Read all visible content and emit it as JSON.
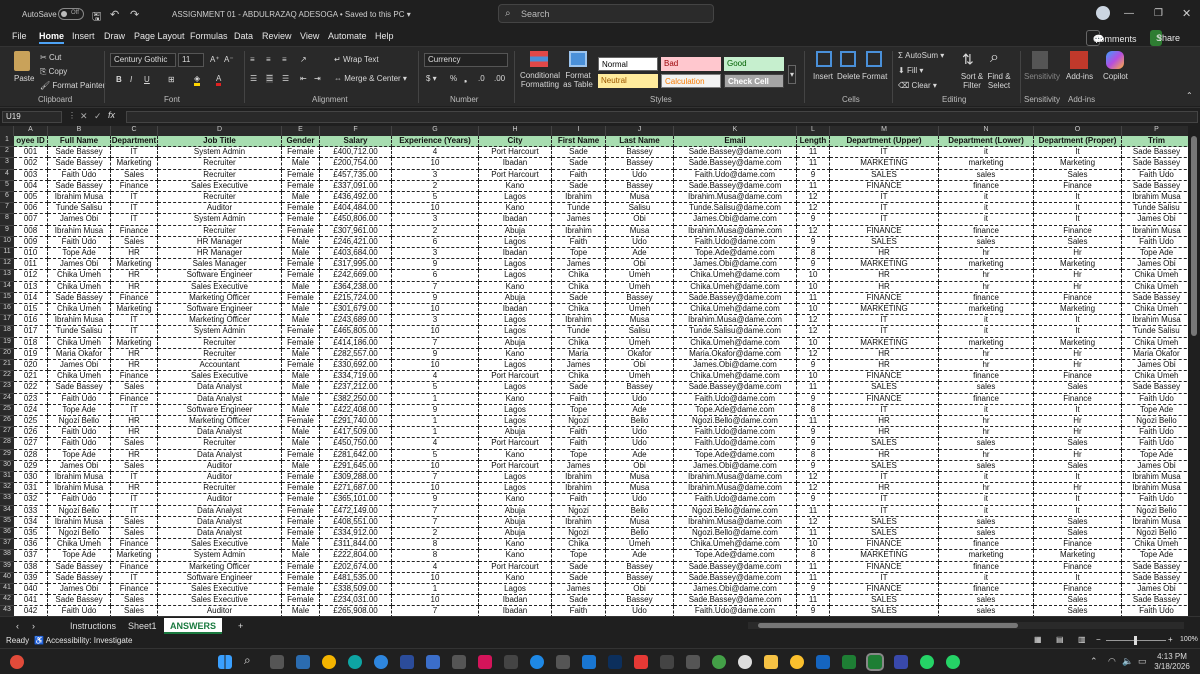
{
  "titlebar": {
    "autosave": "AutoSave",
    "autosave_state": "Off",
    "doc": "ASSIGNMENT 01 - ABDULRAZAQ ADESOGA  •  Saved to this PC ▾",
    "search": "Search"
  },
  "menu": [
    "File",
    "Home",
    "Insert",
    "Draw",
    "Page Layout",
    "Formulas",
    "Data",
    "Review",
    "View",
    "Automate",
    "Help"
  ],
  "comments": "Comments",
  "share": "Share",
  "ribbon": {
    "paste": "Paste",
    "cut": "Cut",
    "copy": "Copy",
    "format_painter": "Format Painter",
    "clipboard": "Clipboard",
    "font_name": "Century Gothic",
    "font_size": "11",
    "font": "Font",
    "wrap_text": "Wrap Text",
    "merge_center": "Merge & Center",
    "alignment": "Alignment",
    "number_format": "Currency",
    "number": "Number",
    "cond_fmt": "Conditional Formatting",
    "format_table": "Format as Table",
    "styles": [
      "Normal",
      "Bad",
      "Good",
      "Neutral",
      "Calculation",
      "Check Cell"
    ],
    "styles_group": "Styles",
    "insert": "Insert",
    "delete": "Delete",
    "format": "Format",
    "cells": "Cells",
    "autosum": "AutoSum",
    "fill": "Fill",
    "clear": "Clear",
    "sort_filter": "Sort & Filter",
    "find_select": "Find & Select",
    "editing": "Editing",
    "sensitivity": "Sensitivity",
    "addins": "Add-ins",
    "copilot": "Copilot",
    "addins_group": "Add-ins"
  },
  "namebox": "U19",
  "columns": [
    "A",
    "B",
    "C",
    "D",
    "E",
    "F",
    "G",
    "H",
    "I",
    "J",
    "K",
    "L",
    "M",
    "N",
    "O",
    "P"
  ],
  "headers": [
    "oyee ID",
    "Full Name",
    "Department",
    "Job Title",
    "Gender",
    "Salary",
    "Experience (Years)",
    "City",
    "First Name",
    "Last Name",
    "Email",
    "Length",
    "Department (Upper)",
    "Department (Lower)",
    "Department (Proper)",
    "Trim"
  ],
  "rows": [
    [
      "001",
      "Sade Bassey",
      "IT",
      "System Admin",
      "Female",
      "£400,712.00",
      "4",
      "Port Harcourt",
      "Sade",
      "Bassey",
      "Sade.Bassey@dame.com",
      "11",
      "IT",
      "it",
      "It",
      "Sade Bassey"
    ],
    [
      "002",
      "Sade Bassey",
      "Marketing",
      "Recruiter",
      "Male",
      "£200,754.00",
      "10",
      "Ibadan",
      "Sade",
      "Bassey",
      "Sade.Bassey@dame.com",
      "11",
      "MARKETING",
      "marketing",
      "Marketing",
      "Sade Bassey"
    ],
    [
      "003",
      "Faith Udo",
      "Sales",
      "Recruiter",
      "Female",
      "£457,735.00",
      "3",
      "Port Harcourt",
      "Faith",
      "Udo",
      "Faith.Udo@dame.com",
      "9",
      "SALES",
      "sales",
      "Sales",
      "Faith Udo"
    ],
    [
      "004",
      "Sade Bassey",
      "Finance",
      "Sales Executive",
      "Female",
      "£337,091.00",
      "2",
      "Kano",
      "Sade",
      "Bassey",
      "Sade.Bassey@dame.com",
      "11",
      "FINANCE",
      "finance",
      "Finance",
      "Sade Bassey"
    ],
    [
      "005",
      "Ibrahim Musa",
      "IT",
      "Recruiter",
      "Male",
      "£436,492.00",
      "5",
      "Lagos",
      "Ibrahim",
      "Musa",
      "Ibrahim.Musa@dame.com",
      "12",
      "IT",
      "it",
      "It",
      "Ibrahim Musa"
    ],
    [
      "006",
      "Tunde Salisu",
      "IT",
      "Auditor",
      "Female",
      "£404,484.00",
      "10",
      "Kano",
      "Tunde",
      "Salisu",
      "Tunde.Salisu@dame.com",
      "12",
      "IT",
      "it",
      "It",
      "Tunde Salisu"
    ],
    [
      "007",
      "James Obi",
      "IT",
      "System Admin",
      "Female",
      "£450,806.00",
      "3",
      "Ibadan",
      "James",
      "Obi",
      "James.Obi@dame.com",
      "9",
      "IT",
      "it",
      "It",
      "James Obi"
    ],
    [
      "008",
      "Ibrahim Musa",
      "Finance",
      "Recruiter",
      "Female",
      "£307,961.00",
      "2",
      "Abuja",
      "Ibrahim",
      "Musa",
      "Ibrahim.Musa@dame.com",
      "12",
      "FINANCE",
      "finance",
      "Finance",
      "Ibrahim Musa"
    ],
    [
      "009",
      "Faith Udo",
      "Sales",
      "HR Manager",
      "Male",
      "£246,421.00",
      "6",
      "Lagos",
      "Faith",
      "Udo",
      "Faith.Udo@dame.com",
      "9",
      "SALES",
      "sales",
      "Sales",
      "Faith Udo"
    ],
    [
      "010",
      "Tope Ade",
      "HR",
      "HR Manager",
      "Male",
      "£403,684.00",
      "3",
      "Ibadan",
      "Tope",
      "Ade",
      "Tope.Ade@dame.com",
      "8",
      "HR",
      "hr",
      "Hr",
      "Tope Ade"
    ],
    [
      "011",
      "James Obi",
      "Marketing",
      "Sales Manager",
      "Female",
      "£317,995.00",
      "9",
      "Lagos",
      "James",
      "Obi",
      "James.Obi@dame.com",
      "9",
      "MARKETING",
      "marketing",
      "Marketing",
      "James Obi"
    ],
    [
      "012",
      "Chika Umeh",
      "HR",
      "Software Engineer",
      "Female",
      "£242,669.00",
      "6",
      "Lagos",
      "Chika",
      "Umeh",
      "Chika.Umeh@dame.com",
      "10",
      "HR",
      "hr",
      "Hr",
      "Chika Umeh"
    ],
    [
      "013",
      "Chika Umeh",
      "HR",
      "Sales Executive",
      "Male",
      "£364,238.00",
      "7",
      "Kano",
      "Chika",
      "Umeh",
      "Chika.Umeh@dame.com",
      "10",
      "HR",
      "hr",
      "Hr",
      "Chika Umeh"
    ],
    [
      "014",
      "Sade Bassey",
      "Finance",
      "Marketing Officer",
      "Female",
      "£215,724.00",
      "9",
      "Abuja",
      "Sade",
      "Bassey",
      "Sade.Bassey@dame.com",
      "11",
      "FINANCE",
      "finance",
      "Finance",
      "Sade Bassey"
    ],
    [
      "015",
      "Chika Umeh",
      "Marketing",
      "Software Engineer",
      "Male",
      "£301,679.00",
      "10",
      "Ibadan",
      "Chika",
      "Umeh",
      "Chika.Umeh@dame.com",
      "10",
      "MARKETING",
      "marketing",
      "Marketing",
      "Chika Umeh"
    ],
    [
      "016",
      "Ibrahim Musa",
      "IT",
      "Marketing Officer",
      "Male",
      "£243,689.00",
      "3",
      "Lagos",
      "Ibrahim",
      "Musa",
      "Ibrahim.Musa@dame.com",
      "12",
      "IT",
      "it",
      "It",
      "Ibrahim Musa"
    ],
    [
      "017",
      "Tunde Salisu",
      "IT",
      "System Admin",
      "Female",
      "£465,805.00",
      "10",
      "Lagos",
      "Tunde",
      "Salisu",
      "Tunde.Salisu@dame.com",
      "12",
      "IT",
      "it",
      "It",
      "Tunde Salisu"
    ],
    [
      "018",
      "Chika Umeh",
      "Marketing",
      "Recruiter",
      "Female",
      "£414,186.00",
      "7",
      "Abuja",
      "Chika",
      "Umeh",
      "Chika.Umeh@dame.com",
      "10",
      "MARKETING",
      "marketing",
      "Marketing",
      "Chika Umeh"
    ],
    [
      "019",
      "Maria Okafor",
      "HR",
      "Recruiter",
      "Male",
      "£282,557.00",
      "9",
      "Kano",
      "Maria",
      "Okafor",
      "Maria.Okafor@dame.com",
      "12",
      "HR",
      "hr",
      "Hr",
      "Maria Okafor"
    ],
    [
      "020",
      "James Obi",
      "HR",
      "Accountant",
      "Female",
      "£330,692.00",
      "10",
      "Lagos",
      "James",
      "Obi",
      "James.Obi@dame.com",
      "9",
      "HR",
      "hr",
      "Hr",
      "James Obi"
    ],
    [
      "021",
      "Chika Umeh",
      "Finance",
      "Sales Executive",
      "Male",
      "£334,719.00",
      "4",
      "Port Harcourt",
      "Chika",
      "Umeh",
      "Chika.Umeh@dame.com",
      "10",
      "FINANCE",
      "finance",
      "Finance",
      "Chika Umeh"
    ],
    [
      "022",
      "Sade Bassey",
      "Sales",
      "Data Analyst",
      "Male",
      "£237,212.00",
      "5",
      "Lagos",
      "Sade",
      "Bassey",
      "Sade.Bassey@dame.com",
      "11",
      "SALES",
      "sales",
      "Sales",
      "Sade Bassey"
    ],
    [
      "023",
      "Faith Udo",
      "Finance",
      "Data Analyst",
      "Male",
      "£382,250.00",
      "1",
      "Kano",
      "Faith",
      "Udo",
      "Faith.Udo@dame.com",
      "9",
      "FINANCE",
      "finance",
      "Finance",
      "Faith Udo"
    ],
    [
      "024",
      "Tope Ade",
      "IT",
      "Software Engineer",
      "Male",
      "£422,408.00",
      "9",
      "Lagos",
      "Tope",
      "Ade",
      "Tope.Ade@dame.com",
      "8",
      "IT",
      "it",
      "It",
      "Tope Ade"
    ],
    [
      "025",
      "Ngozi Bello",
      "HR",
      "Marketing Officer",
      "Female",
      "£291,740.00",
      "1",
      "Lagos",
      "Ngozi",
      "Bello",
      "Ngozi.Bello@dame.com",
      "11",
      "HR",
      "hr",
      "Hr",
      "Ngozi Bello"
    ],
    [
      "026",
      "Faith Udo",
      "HR",
      "Data Analyst",
      "Male",
      "£417,509.00",
      "1",
      "Abuja",
      "Faith",
      "Udo",
      "Faith.Udo@dame.com",
      "9",
      "HR",
      "hr",
      "Hr",
      "Faith Udo"
    ],
    [
      "027",
      "Faith Udo",
      "Sales",
      "Recruiter",
      "Male",
      "£450,750.00",
      "4",
      "Port Harcourt",
      "Faith",
      "Udo",
      "Faith.Udo@dame.com",
      "9",
      "SALES",
      "sales",
      "Sales",
      "Faith Udo"
    ],
    [
      "028",
      "Tope Ade",
      "HR",
      "Data Analyst",
      "Female",
      "£281,642.00",
      "5",
      "Kano",
      "Tope",
      "Ade",
      "Tope.Ade@dame.com",
      "8",
      "HR",
      "hr",
      "Hr",
      "Tope Ade"
    ],
    [
      "029",
      "James Obi",
      "Sales",
      "Auditor",
      "Male",
      "£291,645.00",
      "10",
      "Port Harcourt",
      "James",
      "Obi",
      "James.Obi@dame.com",
      "9",
      "SALES",
      "sales",
      "Sales",
      "James Obi"
    ],
    [
      "030",
      "Ibrahim Musa",
      "IT",
      "Auditor",
      "Female",
      "£309,288.00",
      "7",
      "Lagos",
      "Ibrahim",
      "Musa",
      "Ibrahim.Musa@dame.com",
      "12",
      "IT",
      "it",
      "It",
      "Ibrahim Musa"
    ],
    [
      "031",
      "Ibrahim Musa",
      "HR",
      "Recruiter",
      "Female",
      "£271,687.00",
      "10",
      "Lagos",
      "Ibrahim",
      "Musa",
      "Ibrahim.Musa@dame.com",
      "12",
      "HR",
      "hr",
      "Hr",
      "Ibrahim Musa"
    ],
    [
      "032",
      "Faith Udo",
      "IT",
      "Auditor",
      "Female",
      "£365,101.00",
      "9",
      "Kano",
      "Faith",
      "Udo",
      "Faith.Udo@dame.com",
      "9",
      "IT",
      "it",
      "It",
      "Faith Udo"
    ],
    [
      "033",
      "Ngozi Bello",
      "IT",
      "Data Analyst",
      "Female",
      "£472,149.00",
      "7",
      "Abuja",
      "Ngozi",
      "Bello",
      "Ngozi.Bello@dame.com",
      "11",
      "IT",
      "it",
      "It",
      "Ngozi Bello"
    ],
    [
      "034",
      "Ibrahim Musa",
      "Sales",
      "Data Analyst",
      "Female",
      "£408,551.00",
      "7",
      "Abuja",
      "Ibrahim",
      "Musa",
      "Ibrahim.Musa@dame.com",
      "12",
      "SALES",
      "sales",
      "Sales",
      "Ibrahim Musa"
    ],
    [
      "035",
      "Ngozi Bello",
      "Sales",
      "Data Analyst",
      "Female",
      "£334,912.00",
      "2",
      "Abuja",
      "Ngozi",
      "Bello",
      "Ngozi.Bello@dame.com",
      "11",
      "SALES",
      "sales",
      "Sales",
      "Ngozi Bello"
    ],
    [
      "036",
      "Chika Umeh",
      "Finance",
      "Sales Executive",
      "Male",
      "£311,844.00",
      "8",
      "Kano",
      "Chika",
      "Umeh",
      "Chika.Umeh@dame.com",
      "10",
      "FINANCE",
      "finance",
      "Finance",
      "Chika Umeh"
    ],
    [
      "037",
      "Tope Ade",
      "Marketing",
      "System Admin",
      "Male",
      "£222,804.00",
      "8",
      "Kano",
      "Tope",
      "Ade",
      "Tope.Ade@dame.com",
      "8",
      "MARKETING",
      "marketing",
      "Marketing",
      "Tope Ade"
    ],
    [
      "038",
      "Sade Bassey",
      "Finance",
      "Marketing Officer",
      "Female",
      "£202,674.00",
      "4",
      "Port Harcourt",
      "Sade",
      "Bassey",
      "Sade.Bassey@dame.com",
      "11",
      "FINANCE",
      "finance",
      "Finance",
      "Sade Bassey"
    ],
    [
      "039",
      "Sade Bassey",
      "IT",
      "Software Engineer",
      "Female",
      "£481,535.00",
      "10",
      "Kano",
      "Sade",
      "Bassey",
      "Sade.Bassey@dame.com",
      "11",
      "IT",
      "it",
      "It",
      "Sade Bassey"
    ],
    [
      "040",
      "James Obi",
      "Finance",
      "Sales Executive",
      "Female",
      "£338,509.00",
      "1",
      "Lagos",
      "James",
      "Obi",
      "James.Obi@dame.com",
      "9",
      "FINANCE",
      "finance",
      "Finance",
      "James Obi"
    ],
    [
      "041",
      "Sade Bassey",
      "Sales",
      "Sales Executive",
      "Female",
      "£234,031.00",
      "10",
      "Ibadan",
      "Sade",
      "Bassey",
      "Sade.Bassey@dame.com",
      "11",
      "SALES",
      "sales",
      "Sales",
      "Sade Bassey"
    ],
    [
      "042",
      "Faith Udo",
      "Sales",
      "Auditor",
      "Male",
      "£265,908.00",
      "7",
      "Ibadan",
      "Faith",
      "Udo",
      "Faith.Udo@dame.com",
      "9",
      "SALES",
      "sales",
      "Sales",
      "Faith Udo"
    ]
  ],
  "sheets": [
    "Instructions",
    "Sheet1",
    "ANSWERS"
  ],
  "status": {
    "ready": "Ready",
    "accessibility": "Accessibility: Investigate",
    "zoom": "100%"
  },
  "clock": {
    "time": "4:13 PM",
    "date": "3/18/2026"
  },
  "colors": {
    "header_fill": "#a7ddb0",
    "accent": "#1a7a3f",
    "share": "#2e7d32"
  }
}
